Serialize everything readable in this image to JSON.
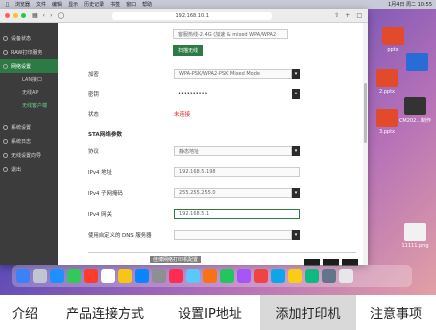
{
  "menubar": {
    "items": [
      "浏览器",
      "文件",
      "编辑",
      "显示",
      "历史记录",
      "书签",
      "窗口",
      "帮助"
    ],
    "clock": "1月4日 周二 10:55"
  },
  "browser": {
    "url": "192.168.10.1"
  },
  "sidebar": {
    "items": [
      {
        "label": "设备状态"
      },
      {
        "label": "RAW打印服务"
      },
      {
        "label": "网络设置"
      },
      {
        "label": "系统设置"
      },
      {
        "label": "系统日志"
      },
      {
        "label": "无线设置向导"
      },
      {
        "label": "退出"
      }
    ],
    "subitems": [
      {
        "label": "LAN接口"
      },
      {
        "label": "无线AP"
      },
      {
        "label": "无线客户端"
      }
    ]
  },
  "form": {
    "top_text": "客服热线-2.4G (加速 & mixed WPA/WPA2",
    "scan_button": "扫描无线",
    "encryption_label": "加密",
    "encryption_value": "WPA-PSK/WPA2-PSK Mixed Mode",
    "key_label": "密钥",
    "key_value": "••••••••••",
    "status_label": "状态",
    "status_value": "未连接",
    "sta_section": "STA网络参数",
    "protocol_label": "协议",
    "protocol_value": "静态地址",
    "ipv4_label": "IPv4 地址",
    "ipv4_value": "192.168.5.198",
    "mask_label": "IPv4 子网掩码",
    "mask_value": "255.255.255.0",
    "gateway_label": "IPv4 网关",
    "gateway_value": "192.168.5.1",
    "dns_label": "使用自定义的 DNS 服务器"
  },
  "caption": "佳博网络打印机配置",
  "desktop_icons": [
    {
      "label": "pptx"
    },
    {
      "label": "2.pptx"
    },
    {
      "label": "3.pptx"
    },
    {
      "label": "CM202...制作"
    },
    {
      "label": "11111.png"
    }
  ],
  "tabs": [
    {
      "label": "介绍"
    },
    {
      "label": "产品连接方式"
    },
    {
      "label": "设置IP地址"
    },
    {
      "label": "添加打印机"
    },
    {
      "label": "注意事项"
    }
  ],
  "colors": {
    "accent": "#2d7a45",
    "error": "#d92020",
    "sidebar_bg": "#3c3c3c"
  }
}
